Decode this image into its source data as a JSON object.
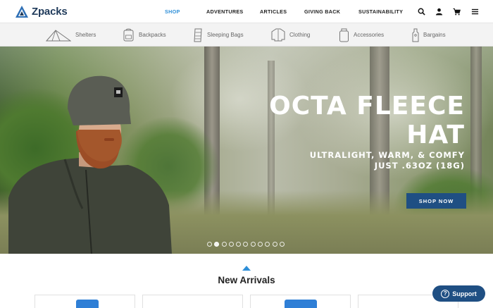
{
  "brand": {
    "name": "Zpacks"
  },
  "main_nav": [
    {
      "label": "SHOP",
      "active": true
    },
    {
      "label": "ADVENTURES",
      "active": false
    },
    {
      "label": "ARTICLES",
      "active": false
    },
    {
      "label": "GIVING BACK",
      "active": false
    },
    {
      "label": "SUSTAINABILITY",
      "active": false
    }
  ],
  "header_icons": [
    "search-icon",
    "account-icon",
    "cart-icon",
    "menu-icon"
  ],
  "categories": [
    {
      "label": "Shelters",
      "icon": "tent-icon"
    },
    {
      "label": "Backpacks",
      "icon": "backpack-icon"
    },
    {
      "label": "Sleeping Bags",
      "icon": "sleeping-bag-icon"
    },
    {
      "label": "Clothing",
      "icon": "jacket-icon"
    },
    {
      "label": "Accessories",
      "icon": "bottle-icon"
    },
    {
      "label": "Bargains",
      "icon": "price-tag-icon"
    }
  ],
  "hero": {
    "title_line1": "OCTA FLEECE",
    "title_line2": "HAT",
    "subtitle_line1": "ULTRALIGHT, WARM, & COMFY",
    "subtitle_line2": "JUST .63OZ (18G)",
    "cta": "SHOP NOW",
    "slide_count": 11,
    "active_slide": 1
  },
  "new_arrivals": {
    "title": "New Arrivals"
  },
  "support": {
    "label": "Support",
    "icon": "question-icon"
  },
  "colors": {
    "accent": "#2e8fd8",
    "brand_navy": "#1f4f83"
  }
}
